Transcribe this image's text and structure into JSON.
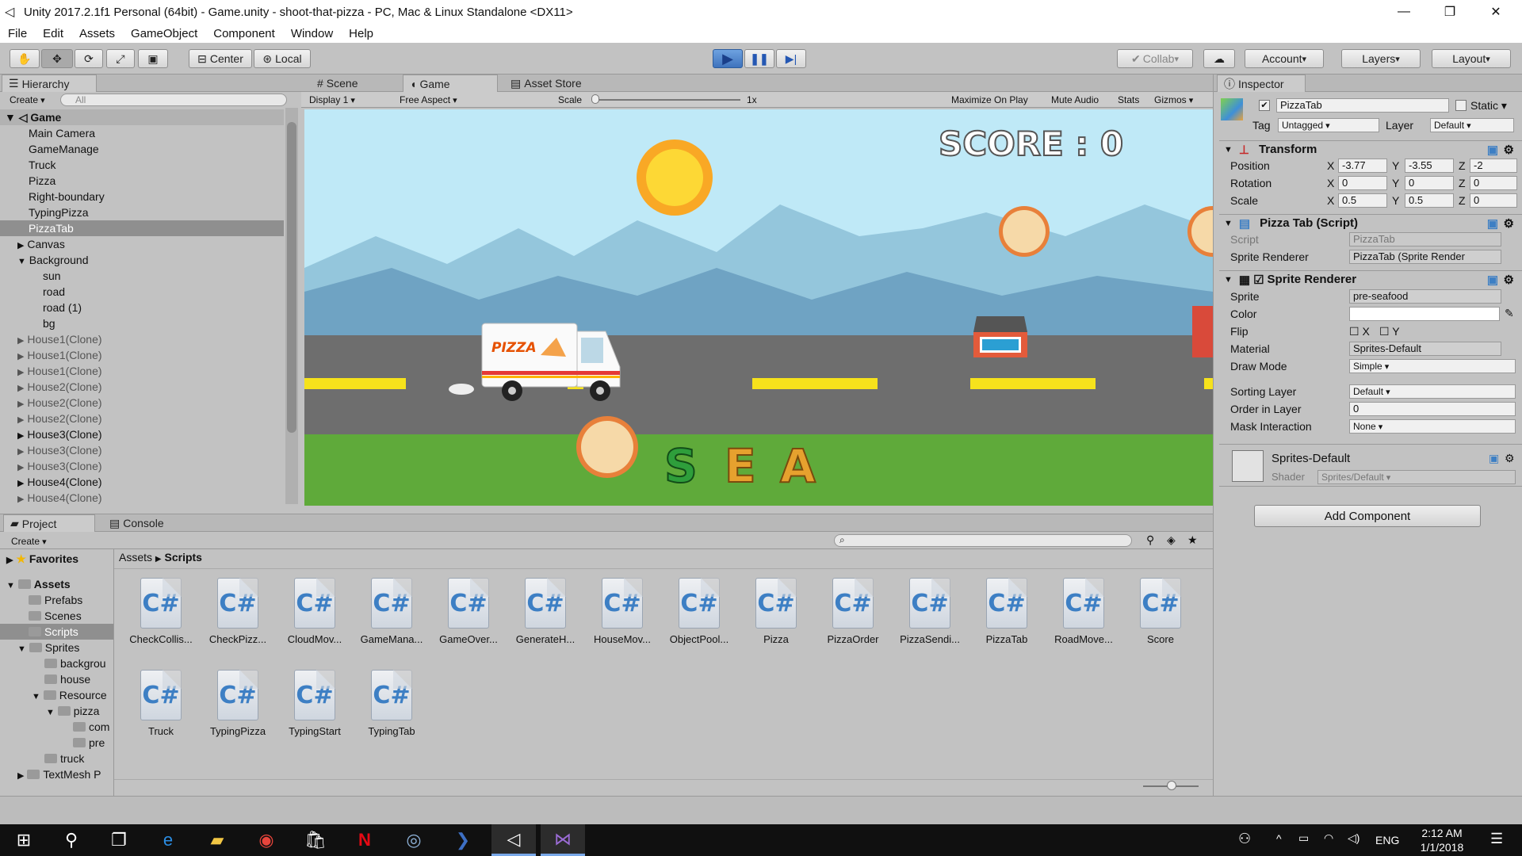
{
  "window": {
    "title": "Unity 2017.2.1f1 Personal (64bit) - Game.unity - shoot-that-pizza - PC, Mac & Linux Standalone <DX11>"
  },
  "menu": [
    "File",
    "Edit",
    "Assets",
    "GameObject",
    "Component",
    "Window",
    "Help"
  ],
  "toolbar": {
    "center": "Center",
    "local": "Local",
    "collab": "Collab",
    "account": "Account",
    "layers": "Layers",
    "layout": "Layout"
  },
  "hierarchy": {
    "tab": "Hierarchy",
    "create": "Create",
    "search_placeholder": "All",
    "scene": "Game",
    "items": [
      "Main Camera",
      "GameManage",
      "Truck",
      "Pizza",
      "Right-boundary",
      "TypingPizza",
      "PizzaTab",
      "Canvas",
      "Background",
      "sun",
      "road",
      "road (1)",
      "bg",
      "House1(Clone)",
      "House1(Clone)",
      "House1(Clone)",
      "House2(Clone)",
      "House2(Clone)",
      "House2(Clone)",
      "House3(Clone)",
      "House3(Clone)",
      "House3(Clone)",
      "House4(Clone)",
      "House4(Clone)"
    ]
  },
  "views": {
    "tabs": [
      "Scene",
      "Game",
      "Asset Store"
    ],
    "display": "Display 1",
    "aspect": "Free Aspect",
    "scale_label": "Scale",
    "scale_value": "1x",
    "toggles": [
      "Maximize On Play",
      "Mute Audio",
      "Stats",
      "Gizmos"
    ]
  },
  "game": {
    "score": "SCORE : 0",
    "truck_label": "PIZZA",
    "letters": [
      "S",
      "E",
      "A"
    ]
  },
  "inspector": {
    "tab": "Inspector",
    "object_name": "PizzaTab",
    "static": "Static",
    "tag_label": "Tag",
    "tag": "Untagged",
    "layer_label": "Layer",
    "layer": "Default",
    "transform": {
      "title": "Transform",
      "position_label": "Position",
      "position": [
        "-3.77",
        "-3.55",
        "-2"
      ],
      "rotation_label": "Rotation",
      "rotation": [
        "0",
        "0",
        "0"
      ],
      "scale_label": "Scale",
      "scale": [
        "0.5",
        "0.5",
        "0"
      ]
    },
    "script": {
      "title": "Pizza Tab (Script)",
      "script_label": "Script",
      "script": "PizzaTab",
      "sr_label": "Sprite Renderer",
      "sr": "PizzaTab (Sprite Render"
    },
    "sprite_renderer": {
      "title": "Sprite Renderer",
      "sprite_label": "Sprite",
      "sprite": "pre-seafood",
      "color_label": "Color",
      "flip_label": "Flip",
      "material_label": "Material",
      "material": "Sprites-Default",
      "drawmode_label": "Draw Mode",
      "drawmode": "Simple",
      "sorting_label": "Sorting Layer",
      "sorting": "Default",
      "order_label": "Order in Layer",
      "order": "0",
      "mask_label": "Mask Interaction",
      "mask": "None"
    },
    "material": {
      "name": "Sprites-Default",
      "shader_label": "Shader",
      "shader": "Sprites/Default"
    },
    "add_component": "Add Component"
  },
  "project": {
    "tabs": [
      "Project",
      "Console"
    ],
    "create": "Create",
    "favorites": "Favorites",
    "breadcrumb": [
      "Assets",
      "Scripts"
    ],
    "tree": [
      "Assets",
      "Prefabs",
      "Scenes",
      "Scripts",
      "Sprites",
      "backgrou",
      "house",
      "Resource",
      "pizza",
      "com",
      "pre",
      "truck",
      "TextMesh P"
    ],
    "files": [
      "CheckCollis...",
      "CheckPizz...",
      "CloudMov...",
      "GameMana...",
      "GameOver...",
      "GenerateH...",
      "HouseMov...",
      "ObjectPool...",
      "Pizza",
      "PizzaOrder",
      "PizzaSendi...",
      "PizzaTab",
      "RoadMove...",
      "Score",
      "Truck",
      "TypingPizza",
      "TypingStart",
      "TypingTab"
    ]
  },
  "taskbar": {
    "lang": "ENG",
    "time": "2:12 AM",
    "date": "1/1/2018"
  }
}
